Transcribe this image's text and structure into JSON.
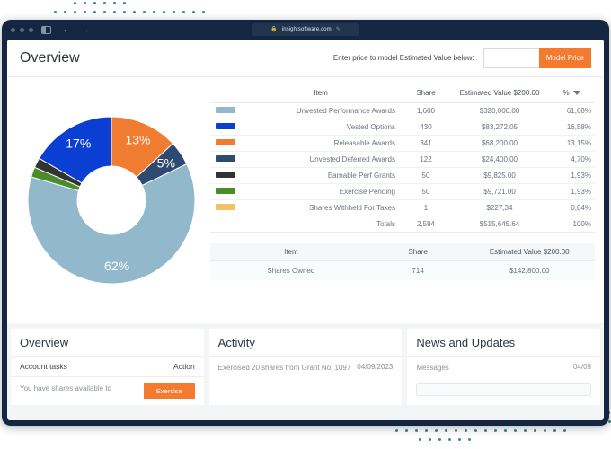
{
  "browser": {
    "window_dots": [
      "dot",
      "dot",
      "dot"
    ],
    "sidebar_toggle": "sidebar-toggle",
    "back_label": "←",
    "forward_label": "→",
    "lock_icon": "🔒",
    "url": "insightsoftware.com",
    "edit_icon": "✎"
  },
  "header": {
    "title": "Overview",
    "price_prompt": "Enter price to model Estimated Value below:",
    "price_value": "",
    "price_placeholder": "",
    "model_button": "Model Price"
  },
  "table": {
    "columns": {
      "swatch": "",
      "item": "Item",
      "share": "Share",
      "value": "Estimated Value $200.00",
      "pct": "%"
    },
    "rows": [
      {
        "color": "#92b8cc",
        "item": "Unvested Performance Awards",
        "share": "1,600",
        "value": "$320,000.00",
        "pct": "61,68%"
      },
      {
        "color": "#0b3fd4",
        "item": "Vested Options",
        "share": "430",
        "value": "$83,272.05",
        "pct": "16,58%"
      },
      {
        "color": "#f07c32",
        "item": "Releasable Awards",
        "share": "341",
        "value": "$68,200.00",
        "pct": "13,15%"
      },
      {
        "color": "#2e4a70",
        "item": "Unvested Deferred Awards",
        "share": "122",
        "value": "$24,400.00",
        "pct": "4,70%"
      },
      {
        "color": "#333333",
        "item": "Earnable Perf Grants",
        "share": "50",
        "value": "$9,825.00",
        "pct": "1,93%"
      },
      {
        "color": "#4a8c28",
        "item": "Exercise Pending",
        "share": "50",
        "value": "$9,721.00",
        "pct": "1,93%"
      },
      {
        "color": "#f5bf63",
        "item": "Shares Withheld For Taxes",
        "share": "1",
        "value": "$227,34",
        "pct": "0,04%"
      }
    ],
    "totals": {
      "item": "Totals",
      "share": "2,594",
      "value": "$515,645.64",
      "pct": "100%"
    }
  },
  "subtable": {
    "columns": {
      "item": "Item",
      "share": "Share",
      "value": "Estimated Value $200.00"
    },
    "rows": [
      {
        "item": "Shares Owned",
        "share": "714",
        "value": "$142,800.00"
      }
    ]
  },
  "cards": {
    "overview": {
      "title": "Overview",
      "col_left": "Account tasks",
      "col_right": "Action",
      "row_text": "You have shares available to",
      "button": "Exercise"
    },
    "activity": {
      "title": "Activity",
      "row_text": "Exercised 20 shares from Grant No. 1097",
      "row_date": "04/09/2023"
    },
    "news": {
      "title": "News and Updates",
      "row_text": "Messages",
      "row_date": "04/09"
    }
  },
  "chart_data": {
    "type": "pie",
    "title": "",
    "donut": true,
    "legend_position": "right",
    "labels": [
      "Releasable Awards",
      "Unvested Deferred Awards",
      "Unvested Performance Awards",
      "Exercise Pending",
      "Earnable Perf Grants",
      "Vested Options",
      "Shares Withheld For Taxes"
    ],
    "values": [
      13.15,
      4.7,
      61.68,
      1.93,
      1.93,
      16.58,
      0.04
    ],
    "colors": [
      "#f07c32",
      "#2e4a70",
      "#92b8cc",
      "#4a8c28",
      "#333333",
      "#0b3fd4",
      "#f5bf63"
    ],
    "visible_labels": [
      "13%",
      "5%",
      "62%",
      "",
      "",
      "17%",
      ""
    ],
    "start_angle_deg": 0,
    "direction": "clockwise"
  }
}
